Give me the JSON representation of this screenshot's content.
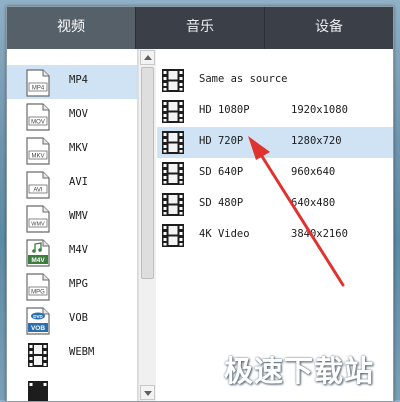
{
  "tabs": [
    {
      "label": "视频",
      "active": true
    },
    {
      "label": "音乐",
      "active": false
    },
    {
      "label": "设备",
      "active": false
    }
  ],
  "formats": [
    {
      "icon_text": "MP4",
      "label": "MP4",
      "selected": true
    },
    {
      "icon_text": "MOV",
      "label": "MOV",
      "selected": false
    },
    {
      "icon_text": "MKV",
      "label": "MKV",
      "selected": false
    },
    {
      "icon_text": "AVI",
      "label": "AVI",
      "selected": false
    },
    {
      "icon_text": "WMV",
      "label": "WMV",
      "selected": false
    },
    {
      "icon_text": "M4V",
      "label": "M4V",
      "selected": false
    },
    {
      "icon_text": "MPG",
      "label": "MPG",
      "selected": false
    },
    {
      "icon_text": "VOB",
      "label": "VOB",
      "selected": false
    },
    {
      "icon_text": "",
      "label": "WEBM",
      "selected": false
    }
  ],
  "resolutions": [
    {
      "name": "Same as source",
      "size": "",
      "selected": false
    },
    {
      "name": "HD 1080P",
      "size": "1920x1080",
      "selected": false
    },
    {
      "name": "HD 720P",
      "size": "1280x720",
      "selected": true
    },
    {
      "name": "SD 640P",
      "size": "960x640",
      "selected": false
    },
    {
      "name": "SD 480P",
      "size": "640x480",
      "selected": false
    },
    {
      "name": "4K Video",
      "size": "3840x2160",
      "selected": false
    }
  ],
  "watermark": "极速下载站",
  "colors": {
    "tab_bar": "#3b4048",
    "tab_active": "#566069",
    "selection": "#cfe3f4",
    "arrow": "#e0322e",
    "m4v_icon": "#3d7d3f",
    "vob_icon": "#2a6fb0"
  }
}
